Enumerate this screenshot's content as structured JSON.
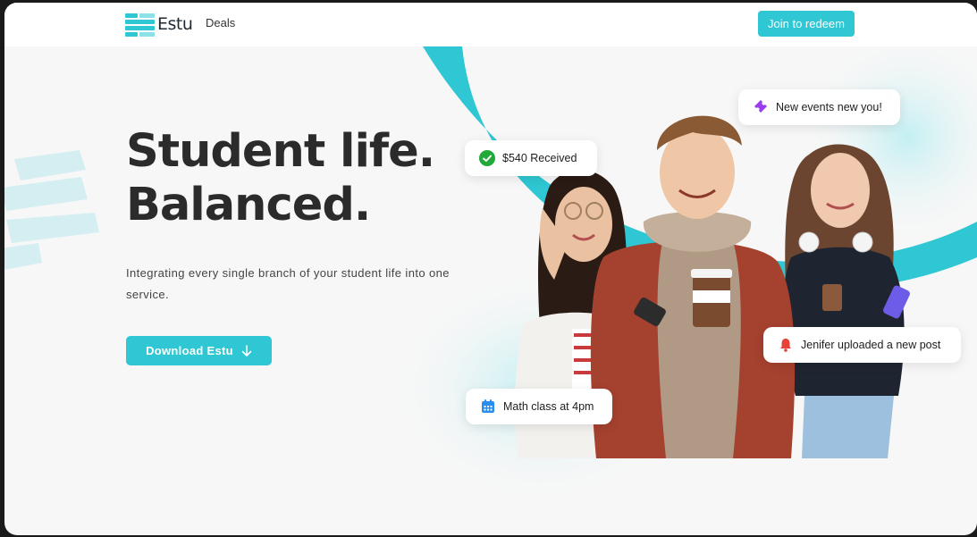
{
  "header": {
    "logo_text": "Estu",
    "nav": {
      "deals_label": "Deals"
    },
    "cta_label": "Join to redeem"
  },
  "hero": {
    "title_line1": "Student life.",
    "title_line2": "Balanced.",
    "subtitle_line1": "Integrating every single branch of your student life into one",
    "subtitle_line2": "service.",
    "download_label": "Download Estu"
  },
  "cards": {
    "received": {
      "label": "$540 Received",
      "icon": "check-circle-icon"
    },
    "events": {
      "label": "New events new you!",
      "icon": "ticket-icon"
    },
    "upload": {
      "label": "Jenifer uploaded a new post",
      "icon": "bell-icon"
    },
    "math": {
      "label": "Math class at 4pm",
      "icon": "calendar-icon"
    }
  },
  "colors": {
    "accent": "#2ec7d3",
    "text_dark": "#2b2b2b",
    "success": "#22a93a",
    "purple": "#9b3cf0",
    "alert": "#e8413a",
    "calendar": "#2a8ef0"
  }
}
